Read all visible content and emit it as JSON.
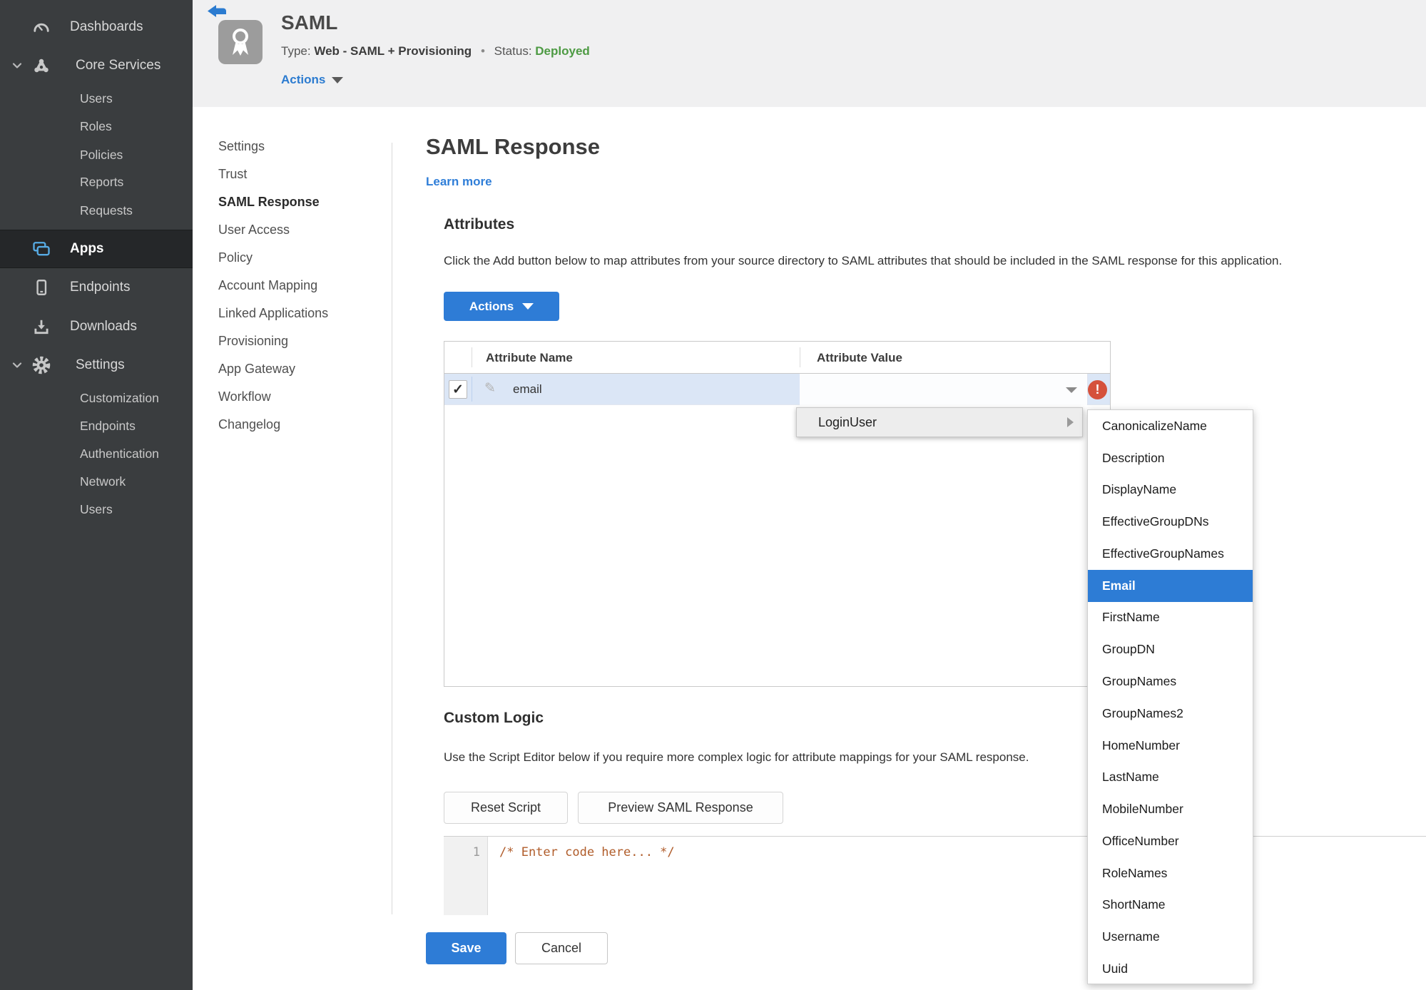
{
  "colors": {
    "accent_blue": "#2e7cd6",
    "status_green": "#4d9a43",
    "error_red": "#d5513c",
    "sidebar_bg": "#3a3d3f"
  },
  "icons": {
    "check": "✓",
    "pencil": "✎",
    "exclamation": "!",
    "dot": "•"
  },
  "sidebar": {
    "items": [
      {
        "label": "Dashboards"
      },
      {
        "label": "Core Services"
      },
      {
        "label": "Users"
      },
      {
        "label": "Roles"
      },
      {
        "label": "Policies"
      },
      {
        "label": "Reports"
      },
      {
        "label": "Requests"
      },
      {
        "label": "Apps"
      },
      {
        "label": "Endpoints"
      },
      {
        "label": "Downloads"
      },
      {
        "label": "Settings"
      },
      {
        "label": "Customization"
      },
      {
        "label": "Endpoints"
      },
      {
        "label": "Authentication"
      },
      {
        "label": "Network"
      },
      {
        "label": "Users"
      }
    ],
    "active": "Apps"
  },
  "header": {
    "app_title": "SAML",
    "type_label": "Type:",
    "type_value": "Web - SAML + Provisioning",
    "separator": "•",
    "status_label": "Status:",
    "status_value": "Deployed",
    "actions_label": "Actions"
  },
  "subnav": {
    "items": [
      "Settings",
      "Trust",
      "SAML Response",
      "User Access",
      "Policy",
      "Account Mapping",
      "Linked Applications",
      "Provisioning",
      "App Gateway",
      "Workflow",
      "Changelog"
    ],
    "active": "SAML Response"
  },
  "main": {
    "title": "SAML Response",
    "learn_more": "Learn more",
    "attributes": {
      "heading": "Attributes",
      "description": "Click the Add button below to map attributes from your source directory to SAML attributes that should be included in the SAML response for this application.",
      "actions_button": "Actions",
      "table": {
        "columns": [
          "Attribute Name",
          "Attribute Value"
        ],
        "rows": [
          {
            "checked": true,
            "name": "email",
            "value": ""
          }
        ]
      }
    },
    "value_menu": {
      "root_item": "LoginUser",
      "options": [
        "CanonicalizeName",
        "Description",
        "DisplayName",
        "EffectiveGroupDNs",
        "EffectiveGroupNames",
        "Email",
        "FirstName",
        "GroupDN",
        "GroupNames",
        "GroupNames2",
        "HomeNumber",
        "LastName",
        "MobileNumber",
        "OfficeNumber",
        "RoleNames",
        "ShortName",
        "Username",
        "Uuid"
      ],
      "selected": "Email"
    },
    "custom_logic": {
      "heading": "Custom Logic",
      "description": "Use the Script Editor below if you require more complex logic for attribute mappings for your SAML response.",
      "reset_button": "Reset Script",
      "preview_button": "Preview SAML Response",
      "editor": {
        "line_number": "1",
        "code": "/* Enter code here... */"
      }
    },
    "save_button": "Save",
    "cancel_button": "Cancel"
  }
}
